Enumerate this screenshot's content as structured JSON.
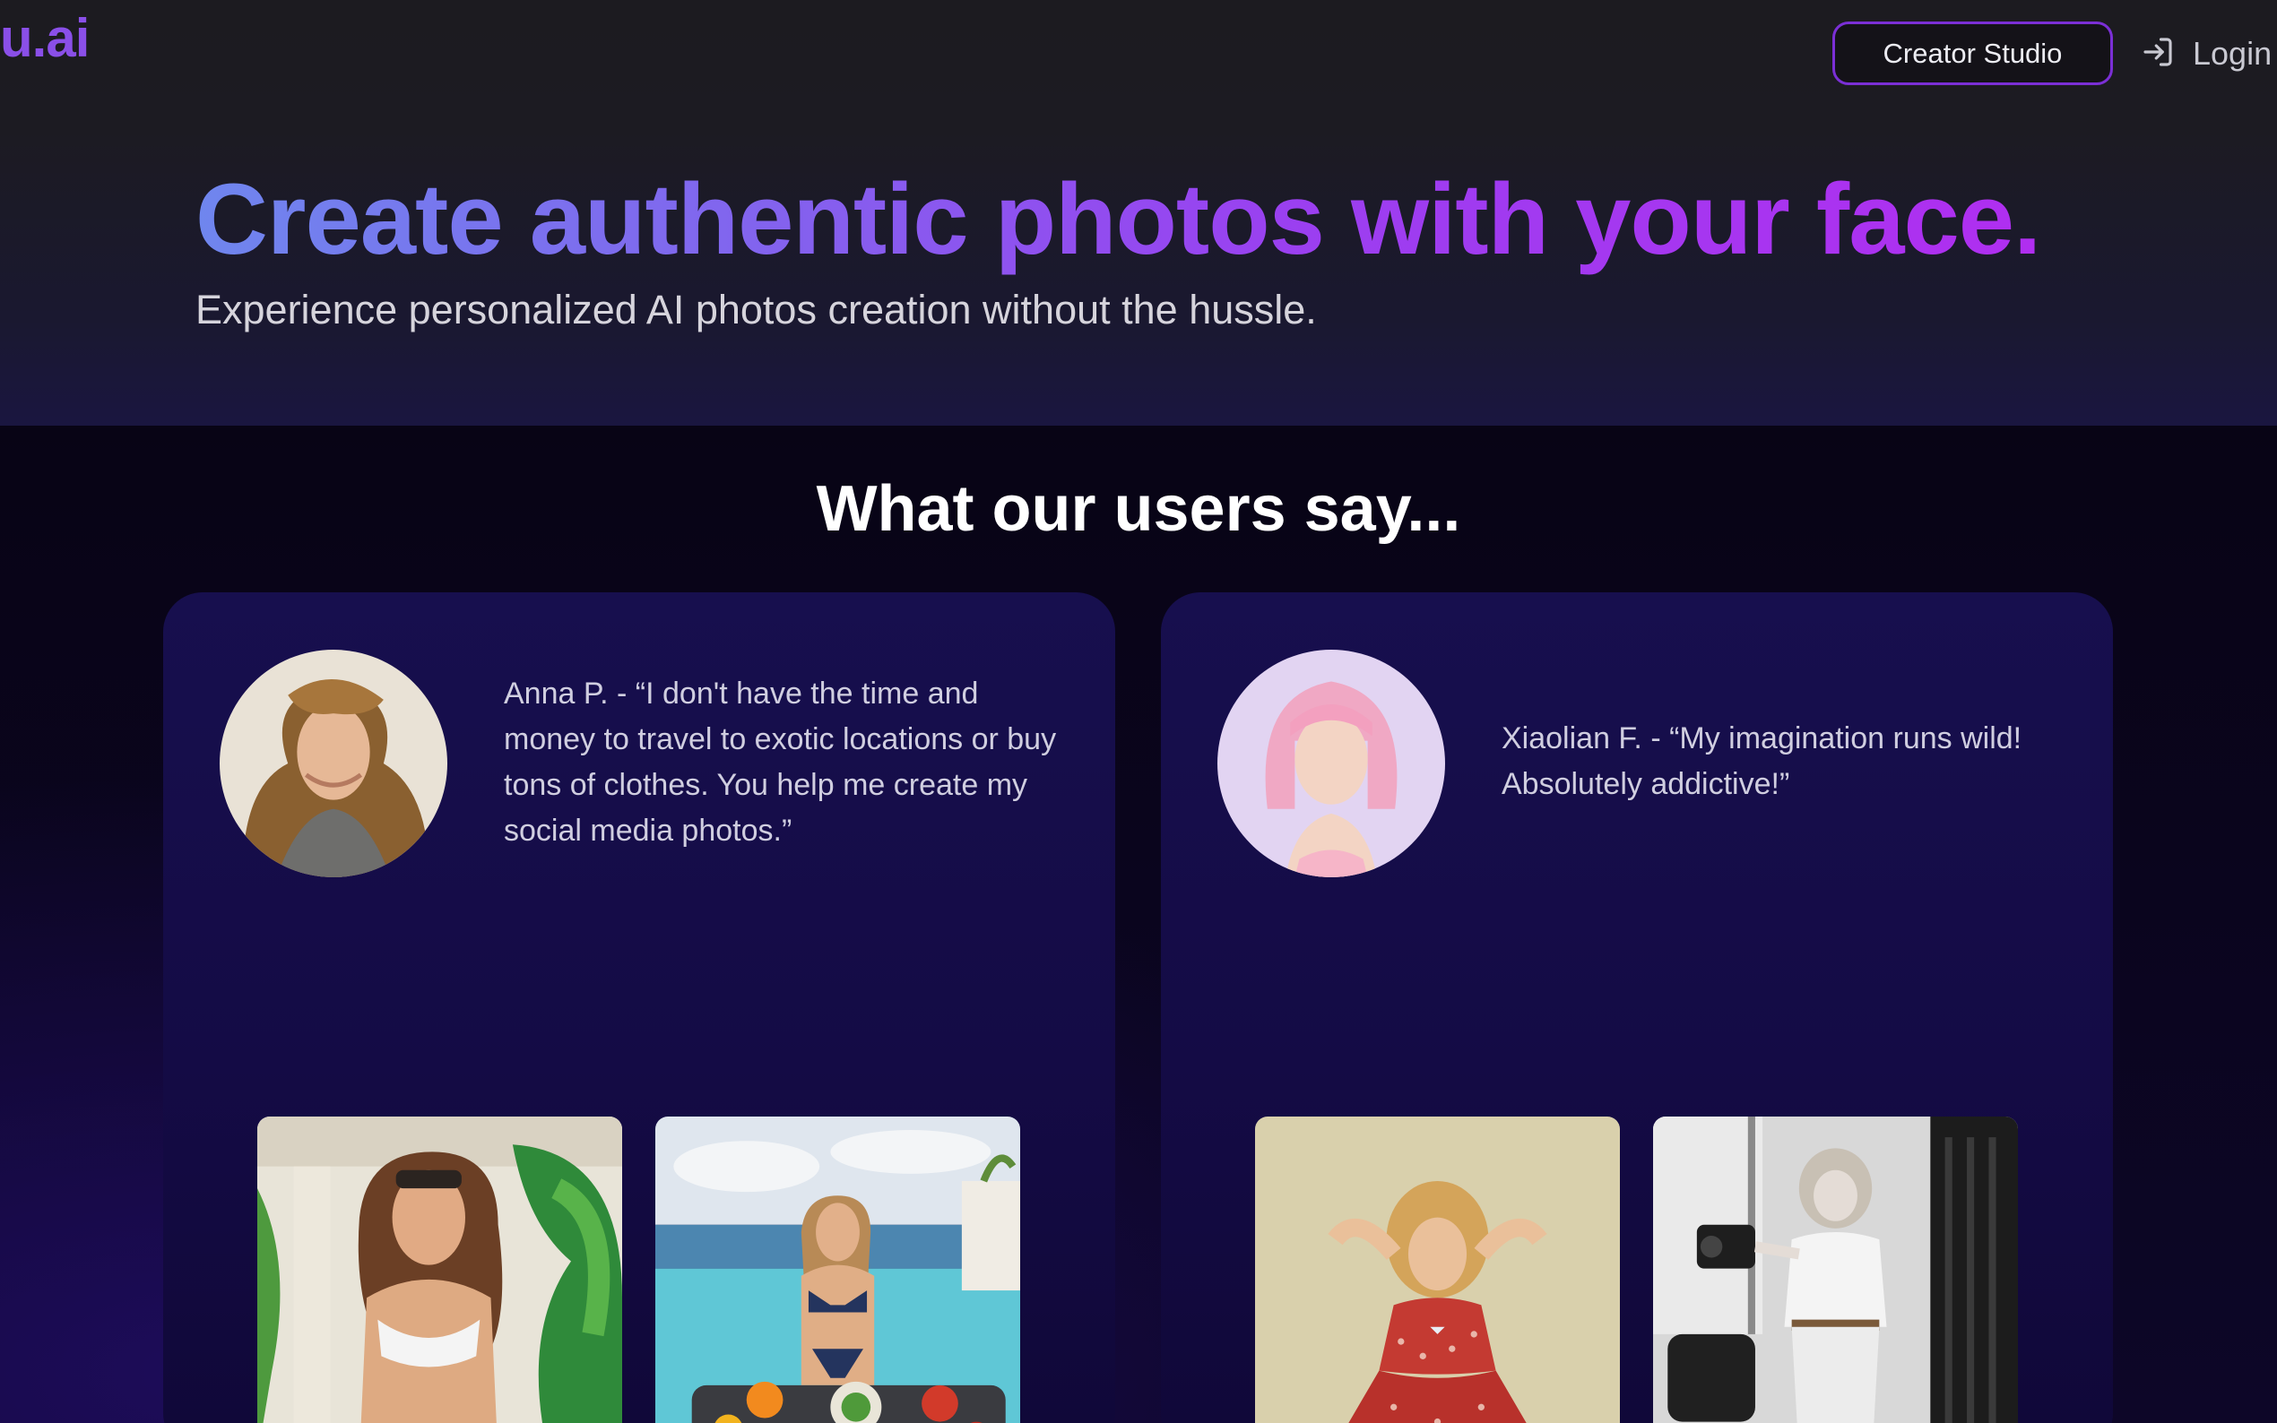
{
  "header": {
    "logo_text": "u.ai",
    "creator_studio_label": "Creator Studio",
    "login_label": "Login",
    "login_icon": "login-arrow-icon"
  },
  "hero": {
    "title": "Create authentic photos with your face.",
    "subtitle": "Experience personalized AI photos creation without the hussle."
  },
  "testimonials": {
    "heading": "What our users say...",
    "cards": [
      {
        "quote": "Anna P. - “I don't have the time and money to travel to exotic locations or buy tons of clothes. You help me create my social media photos.”",
        "avatar": "woman-portrait-avatar",
        "photos": [
          "woman-tropical-patio-photo",
          "woman-infinity-pool-photo"
        ]
      },
      {
        "quote": "Xiaolian F. - “My imagination runs wild! Absolutely addictive!”",
        "avatar": "pink-hair-woman-avatar",
        "photos": [
          "retro-pinup-dress-photo",
          "black-white-street-camera-photo"
        ]
      }
    ]
  },
  "colors": {
    "brand_purple": "#8a4fe8",
    "button_border": "#7b2fd6",
    "gradient_start": "#6f86ee",
    "gradient_end": "#b02ef0",
    "card_bg": "#170f4e"
  }
}
